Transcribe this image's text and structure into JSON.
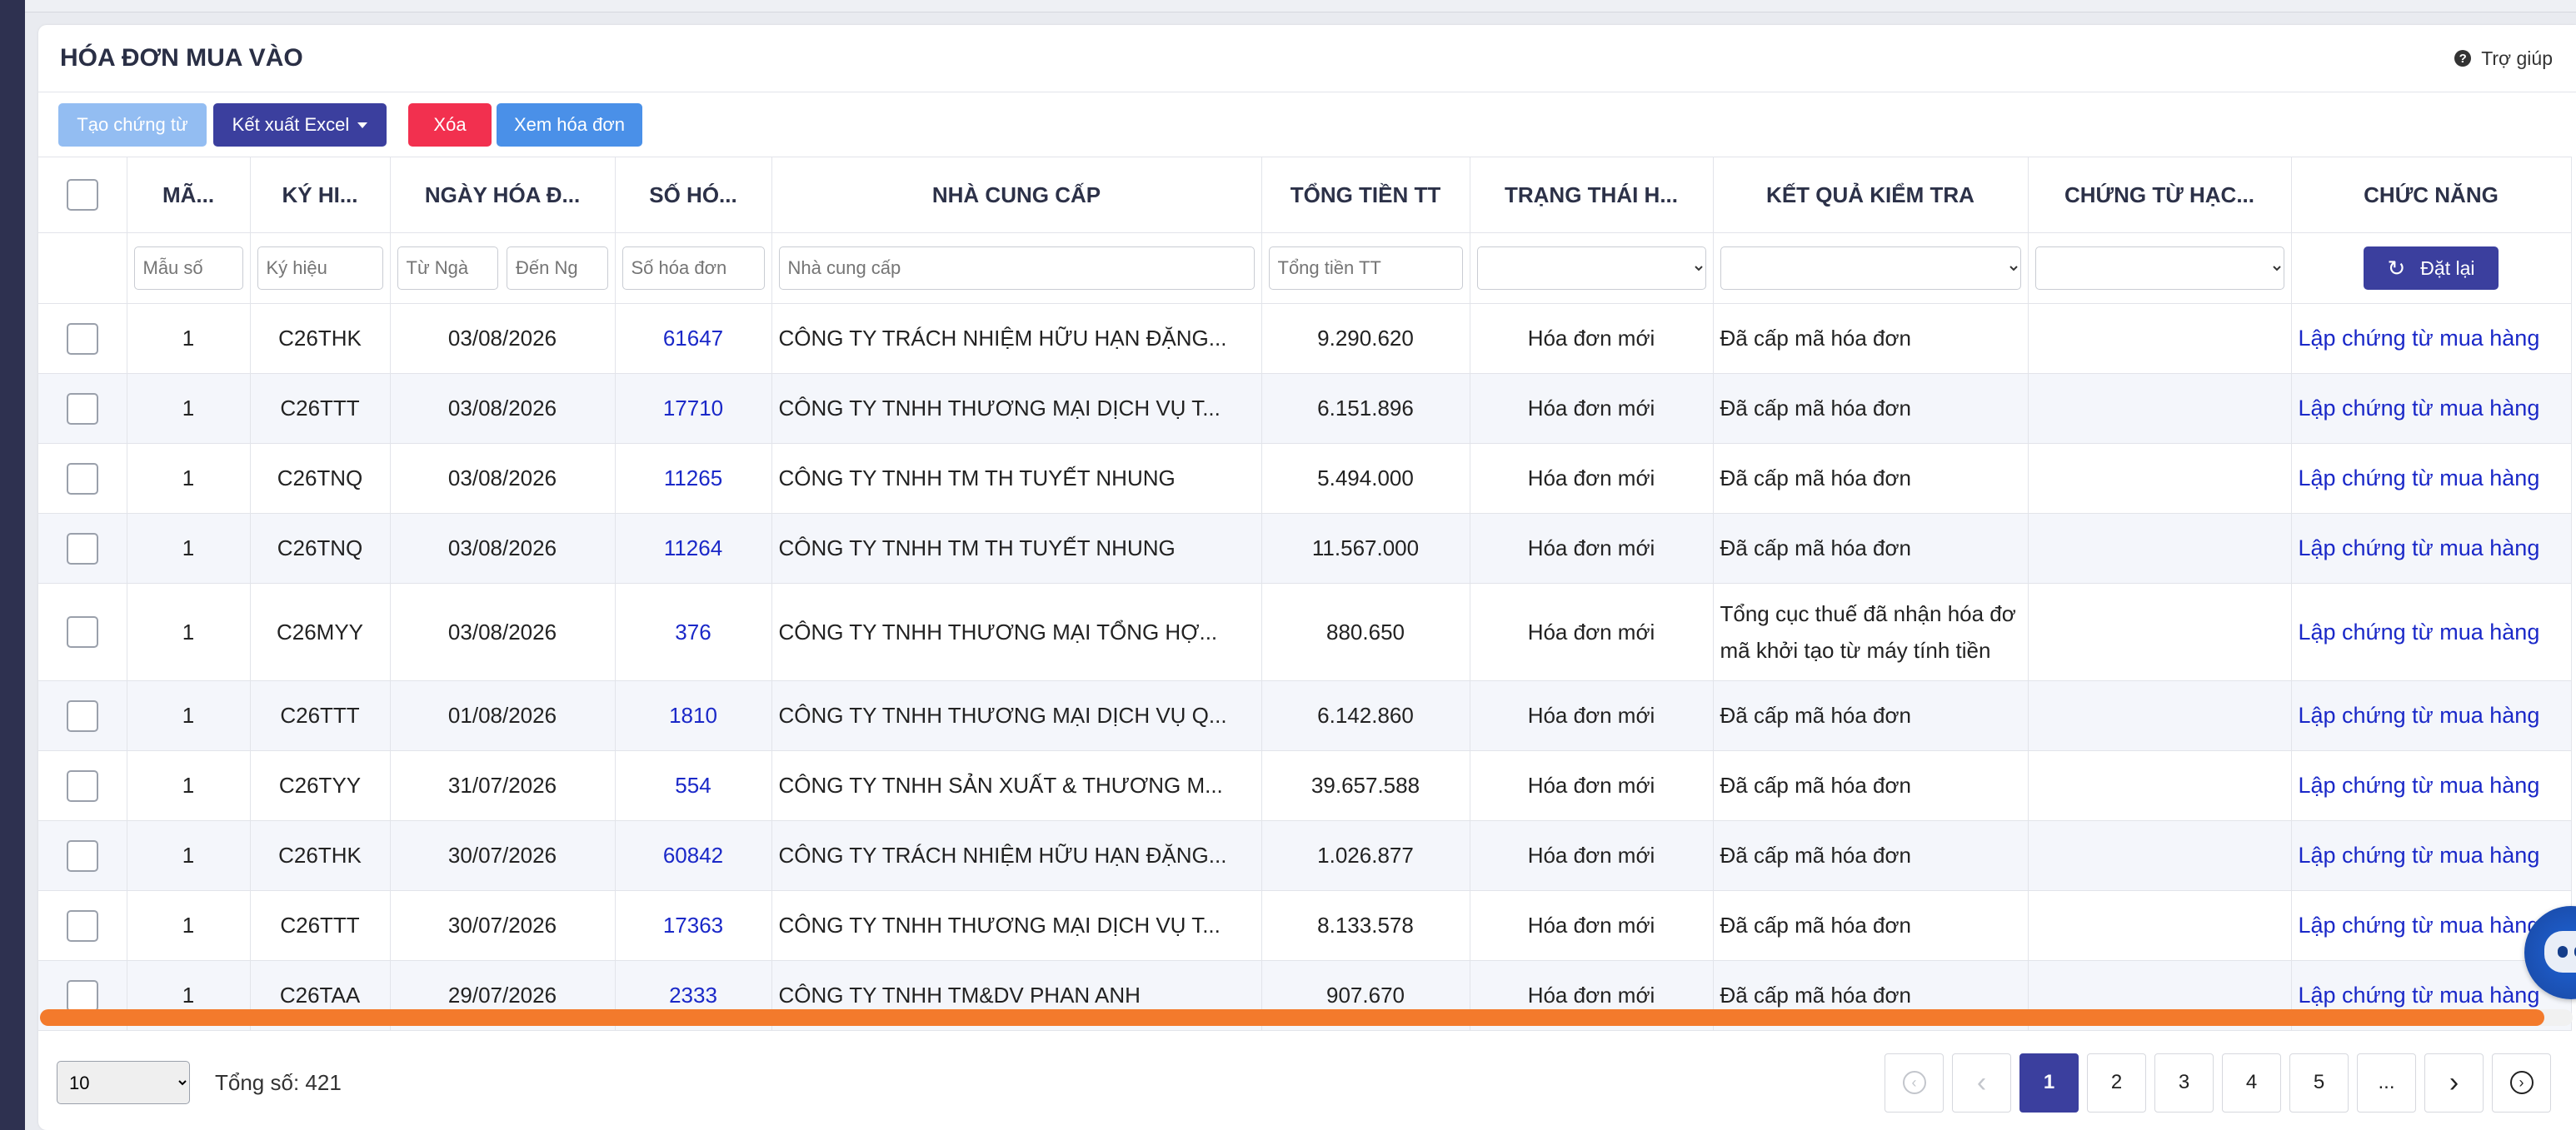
{
  "page": {
    "title": "HÓA ĐƠN MUA VÀO",
    "help_label": "Trợ giúp"
  },
  "toolbar": {
    "create_label": "Tạo chứng từ",
    "export_label": "Kết xuất Excel",
    "delete_label": "Xóa",
    "view_label": "Xem hóa đơn"
  },
  "columns": [
    "MÃ...",
    "KÝ HI...",
    "NGÀY HÓA Đ...",
    "SỐ HÓ...",
    "NHÀ CUNG CẤP",
    "TỔNG TIỀN TT",
    "TRẠNG THÁI H...",
    "KẾT QUẢ KIỂM TRA",
    "CHỨNG TỪ HẠC...",
    "CHỨC NĂNG"
  ],
  "filters": {
    "form_placeholder": "Mẫu số",
    "symbol_placeholder": "Ký hiệu",
    "from_placeholder": "Từ Ngà",
    "to_placeholder": "Đến Ng",
    "number_placeholder": "Số hóa đơn",
    "supplier_placeholder": "Nhà cung cấp",
    "total_placeholder": "Tổng tiền TT",
    "reset_label": "Đặt lại"
  },
  "rows": [
    {
      "form": "1",
      "symbol": "C26THK",
      "date": "03/08/2026",
      "number": "61647",
      "supplier": "CÔNG TY TRÁCH NHIỆM HỮU HẠN ĐẶNG...",
      "total": "9.290.620",
      "status": "Hóa đơn mới",
      "check": "Đã cấp mã hóa đơn",
      "voucher": "",
      "action": "Lập chứng từ mua hàng"
    },
    {
      "form": "1",
      "symbol": "C26TTT",
      "date": "03/08/2026",
      "number": "17710",
      "supplier": "CÔNG TY TNHH THƯƠNG MẠI DỊCH VỤ T...",
      "total": "6.151.896",
      "status": "Hóa đơn mới",
      "check": "Đã cấp mã hóa đơn",
      "voucher": "",
      "action": "Lập chứng từ mua hàng"
    },
    {
      "form": "1",
      "symbol": "C26TNQ",
      "date": "03/08/2026",
      "number": "11265",
      "supplier": "CÔNG TY TNHH TM TH TUYẾT NHUNG",
      "total": "5.494.000",
      "status": "Hóa đơn mới",
      "check": "Đã cấp mã hóa đơn",
      "voucher": "",
      "action": "Lập chứng từ mua hàng"
    },
    {
      "form": "1",
      "symbol": "C26TNQ",
      "date": "03/08/2026",
      "number": "11264",
      "supplier": "CÔNG TY TNHH TM TH TUYẾT NHUNG",
      "total": "11.567.000",
      "status": "Hóa đơn mới",
      "check": "Đã cấp mã hóa đơn",
      "voucher": "",
      "action": "Lập chứng từ mua hàng"
    },
    {
      "form": "1",
      "symbol": "C26MYY",
      "date": "03/08/2026",
      "number": "376",
      "supplier": "CÔNG TY TNHH THƯƠNG MẠI TỔNG HỢ...",
      "total": "880.650",
      "status": "Hóa đơn mới",
      "check": "Tổng cục thuế đã nhận hóa đơ mã khởi tạo từ máy tính tiền",
      "voucher": "",
      "action": "Lập chứng từ mua hàng"
    },
    {
      "form": "1",
      "symbol": "C26TTT",
      "date": "01/08/2026",
      "number": "1810",
      "supplier": "CÔNG TY TNHH THƯƠNG MẠI DỊCH VỤ Q...",
      "total": "6.142.860",
      "status": "Hóa đơn mới",
      "check": "Đã cấp mã hóa đơn",
      "voucher": "",
      "action": "Lập chứng từ mua hàng"
    },
    {
      "form": "1",
      "symbol": "C26TYY",
      "date": "31/07/2026",
      "number": "554",
      "supplier": "CÔNG TY TNHH SẢN XUẤT & THƯƠNG M...",
      "total": "39.657.588",
      "status": "Hóa đơn mới",
      "check": "Đã cấp mã hóa đơn",
      "voucher": "",
      "action": "Lập chứng từ mua hàng"
    },
    {
      "form": "1",
      "symbol": "C26THK",
      "date": "30/07/2026",
      "number": "60842",
      "supplier": "CÔNG TY TRÁCH NHIỆM HỮU HẠN ĐẶNG...",
      "total": "1.026.877",
      "status": "Hóa đơn mới",
      "check": "Đã cấp mã hóa đơn",
      "voucher": "",
      "action": "Lập chứng từ mua hàng"
    },
    {
      "form": "1",
      "symbol": "C26TTT",
      "date": "30/07/2026",
      "number": "17363",
      "supplier": "CÔNG TY TNHH THƯƠNG MẠI DỊCH VỤ T...",
      "total": "8.133.578",
      "status": "Hóa đơn mới",
      "check": "Đã cấp mã hóa đơn",
      "voucher": "",
      "action": "Lập chứng từ mua hàng"
    },
    {
      "form": "1",
      "symbol": "C26TAA",
      "date": "29/07/2026",
      "number": "2333",
      "supplier": "CÔNG TY TNHH TM&DV PHAN ANH",
      "total": "907.670",
      "status": "Hóa đơn mới",
      "check": "Đã cấp mã hóa đơn",
      "voucher": "",
      "action": "Lập chứng từ mua hàng"
    }
  ],
  "footer": {
    "page_size": "10",
    "total_text": "Tổng số: 421",
    "pages": [
      "1",
      "2",
      "3",
      "4",
      "5",
      "..."
    ],
    "current_page": "1"
  },
  "colors": {
    "primary": "#3b3f9e",
    "danger": "#f2304f",
    "info": "#4a90e8",
    "disabled_primary": "#93bdf2",
    "link": "#1a28c8",
    "scrollbar": "#f37a2c"
  }
}
